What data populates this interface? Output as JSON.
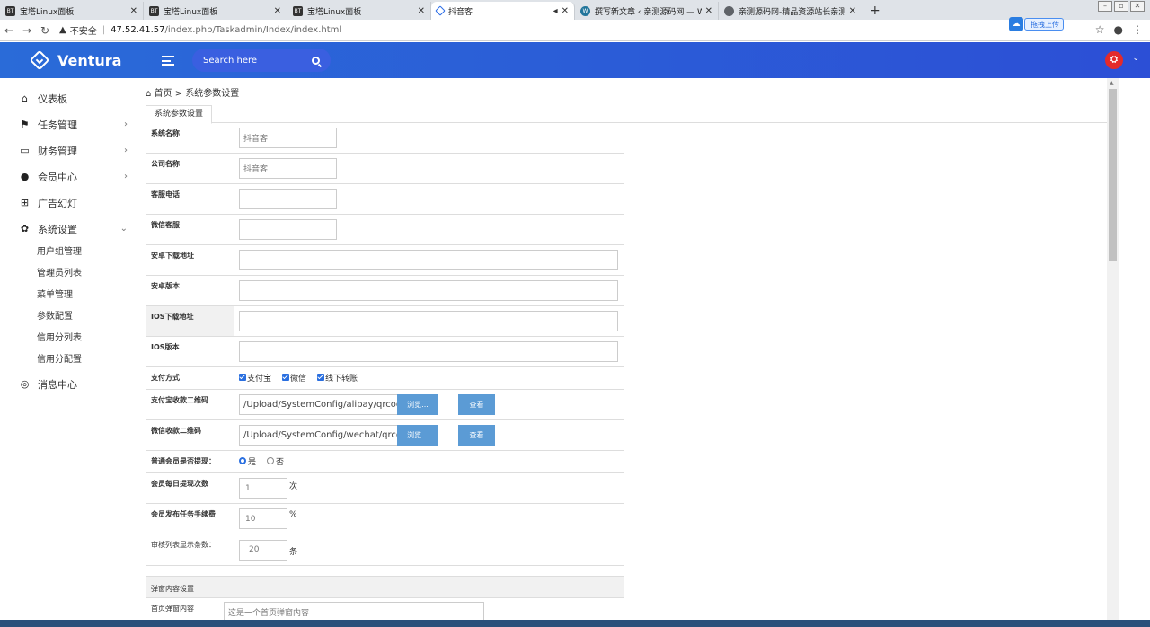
{
  "browser": {
    "tabs": [
      {
        "title": "宝塔Linux面板",
        "icon": "bt-icon"
      },
      {
        "title": "宝塔Linux面板",
        "icon": "bt-icon"
      },
      {
        "title": "宝塔Linux面板",
        "icon": "bt-icon"
      },
      {
        "title": "抖音客",
        "icon": "ventura-icon",
        "active": true
      },
      {
        "title": "撰写新文章 ‹ 亲测源码网 — Wo",
        "icon": "wordpress-icon"
      },
      {
        "title": "亲测源码网-精品资源站长亲测",
        "icon": "globe-icon"
      }
    ],
    "insecure_label": "不安全",
    "url_host": "47.52.41.57",
    "url_path": "/index.php/Taskadmin/Index/index.html",
    "upload_label": "拖拽上传"
  },
  "header": {
    "brand": "Ventura",
    "search_placeholder": "Search here",
    "avatar_glyph": "⛭"
  },
  "sidebar": {
    "items": [
      {
        "label": "仪表板",
        "icon": "home-icon"
      },
      {
        "label": "任务管理",
        "icon": "flag-icon",
        "arrow": "›"
      },
      {
        "label": "财务管理",
        "icon": "card-icon",
        "arrow": "›"
      },
      {
        "label": "会员中心",
        "icon": "user-icon",
        "arrow": "›"
      },
      {
        "label": "广告幻灯",
        "icon": "grid-icon"
      },
      {
        "label": "系统设置",
        "icon": "gear-icon",
        "arrow": "⌄"
      }
    ],
    "sub_items": [
      "用户组管理",
      "管理员列表",
      "菜单管理",
      "参数配置",
      "信用分列表",
      "信用分配置"
    ],
    "last_item": {
      "label": "消息中心",
      "icon": "chat-icon"
    }
  },
  "main": {
    "breadcrumb_home": "首页",
    "breadcrumb_sep": ">",
    "breadcrumb_current": "系统参数设置",
    "tab_label": "系统参数设置",
    "fields": {
      "system_name": {
        "label": "系统名称",
        "value": "抖音客"
      },
      "company_name": {
        "label": "公司名称",
        "value": "抖音客"
      },
      "service_phone": {
        "label": "客服电话",
        "value": ""
      },
      "wechat_service": {
        "label": "微信客服",
        "value": ""
      },
      "android_url": {
        "label": "安卓下载地址",
        "value": ""
      },
      "android_version": {
        "label": "安卓版本",
        "value": ""
      },
      "ios_url": {
        "label": "IOS下载地址",
        "value": ""
      },
      "ios_version": {
        "label": "IOS版本",
        "value": ""
      }
    },
    "payment": {
      "label": "支付方式",
      "options": [
        "支付宝",
        "微信",
        "线下转账"
      ]
    },
    "alipay_qr": {
      "label": "支付宝收款二维码",
      "value": "/Upload/SystemConfig/alipay/qrcode_",
      "browse": "浏览...",
      "view": "查看"
    },
    "wechat_qr": {
      "label": "微信收款二维码",
      "value": "/Upload/SystemConfig/wechat/qrcod",
      "browse": "浏览...",
      "view": "查看"
    },
    "withdraw": {
      "label": "普通会员是否提现：",
      "yes": "是",
      "no": "否"
    },
    "daily_withdraw": {
      "label": "会员每日提现次数",
      "value": "1",
      "unit": "次"
    },
    "task_fee": {
      "label": "会员发布任务手续费",
      "value": "10",
      "unit": "%"
    },
    "review_count": {
      "label": "审核列表显示条数：",
      "value": "20",
      "unit": "条"
    },
    "popup_section": {
      "title": "弹窗内容设置",
      "home_label": "首页弹窗内容",
      "home_value": "这是一个首页弹窗内容"
    }
  }
}
